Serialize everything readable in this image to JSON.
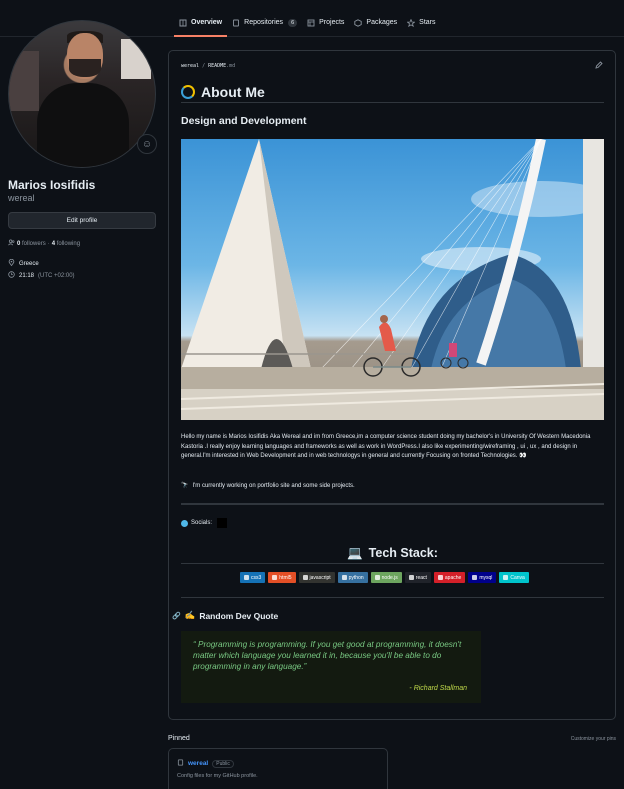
{
  "nav": {
    "tabs": [
      {
        "label": "Overview",
        "icon": "book-icon"
      },
      {
        "label": "Repositories",
        "icon": "repo-icon",
        "count": "6"
      },
      {
        "label": "Projects",
        "icon": "table-icon"
      },
      {
        "label": "Packages",
        "icon": "package-icon"
      },
      {
        "label": "Stars",
        "icon": "star-icon"
      }
    ]
  },
  "profile": {
    "fullname": "Marios Iosifidis",
    "username": "wereal",
    "edit_label": "Edit profile",
    "followers_count": "0",
    "followers_label": "followers",
    "following_count": "4",
    "following_label": "following",
    "location": "Greece",
    "time": "21:18",
    "timezone": "(UTC +02:00)"
  },
  "readme": {
    "path_user": "wereal",
    "path_sep": " / ",
    "path_file": "README",
    "path_ext": ".md",
    "title": "About Me",
    "subtitle": "Design and Development",
    "paragraph": "Hello my name is Marios Iosifidis Aka Wereal and im from Greece,im a computer science student doing my bachelor's in University Of Western Macedonia Kastoria .I really enjoy learning languages and frameworks as well as work in WordPress.I also like experimenting/wireframing , ui , ux , and design in general.I'm interested in Web Development and in web technologys in general and currently Focusing on fronted Technologies. 👀",
    "working": "I'm currently working on portfolio site and some side projects.",
    "socials_label": "Socials:",
    "techstack_title": "Tech Stack:",
    "badges": [
      {
        "label": "css3",
        "color": "#1572b6"
      },
      {
        "label": "html5",
        "color": "#e34f26"
      },
      {
        "label": "javascript",
        "color": "#323330"
      },
      {
        "label": "python",
        "color": "#3670a0"
      },
      {
        "label": "node.js",
        "color": "#6da55f"
      },
      {
        "label": "react",
        "color": "#20232a"
      },
      {
        "label": "apache",
        "color": "#d42029"
      },
      {
        "label": "mysql",
        "color": "#00008b"
      },
      {
        "label": "Canva",
        "color": "#00c4cc"
      }
    ],
    "quote_heading": "Random Dev Quote",
    "quote_text": "“ Programming is programming. If you get good at programming, it doesn't matter which language you learned it in, because you'll be able to do programming in any language.”",
    "quote_author": "- Richard Stallman"
  },
  "pinned": {
    "title": "Pinned",
    "customize_label": "Customize your pins",
    "repo_name": "wereal",
    "visibility": "Public",
    "description": "Config files for my GitHub profile."
  },
  "colors": {
    "background": "#0d1117",
    "border": "#30363d",
    "accent": "#f78166",
    "link": "#4493f8"
  }
}
